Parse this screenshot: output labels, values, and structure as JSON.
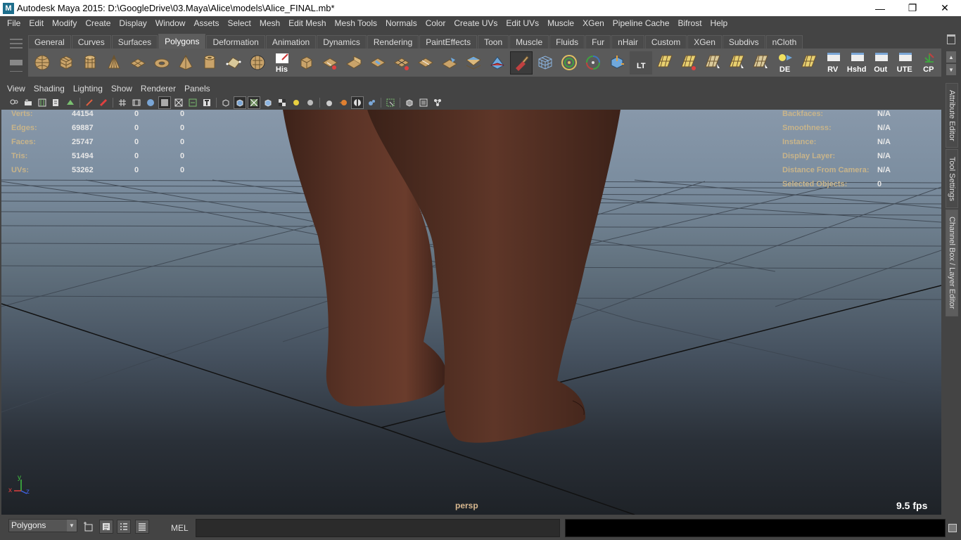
{
  "window": {
    "title": "Autodesk Maya 2015: D:\\GoogleDrive\\03.Maya\\Alice\\models\\Alice_FINAL.mb*",
    "icon_letter": "M",
    "controls": [
      {
        "name": "minimize-icon",
        "glyph": "—"
      },
      {
        "name": "restore-icon",
        "glyph": "❐"
      },
      {
        "name": "close-icon",
        "glyph": "✕"
      }
    ]
  },
  "menubar": [
    "File",
    "Edit",
    "Modify",
    "Create",
    "Display",
    "Window",
    "Assets",
    "Select",
    "Mesh",
    "Edit Mesh",
    "Mesh Tools",
    "Normals",
    "Color",
    "Create UVs",
    "Edit UVs",
    "Muscle",
    "XGen",
    "Pipeline Cache",
    "Bifrost",
    "Help"
  ],
  "shelf": {
    "tabs": [
      "General",
      "Curves",
      "Surfaces",
      "Polygons",
      "Deformation",
      "Animation",
      "Dynamics",
      "Rendering",
      "PaintEffects",
      "Toon",
      "Muscle",
      "Fluids",
      "Fur",
      "nHair",
      "Custom",
      "XGen",
      "Subdivs",
      "nCloth"
    ],
    "active_tab": "Polygons",
    "icons": [
      {
        "name": "poly-sphere-icon"
      },
      {
        "name": "poly-cube-icon"
      },
      {
        "name": "poly-cylinder-icon"
      },
      {
        "name": "poly-cone-icon"
      },
      {
        "name": "poly-plane-icon"
      },
      {
        "name": "poly-torus-icon"
      },
      {
        "name": "poly-pyramid-icon"
      },
      {
        "name": "poly-pipe-icon"
      },
      {
        "name": "create-polygon-tool-icon"
      },
      {
        "name": "sculpt-geometry-icon"
      },
      {
        "name": "history-icon",
        "label": "His"
      },
      {
        "name": "extrude-icon"
      },
      {
        "name": "bevel-icon"
      },
      {
        "name": "bridge-icon"
      },
      {
        "name": "append-polygon-icon"
      },
      {
        "name": "split-polygon-icon"
      },
      {
        "name": "insert-edge-loop-icon"
      },
      {
        "name": "merge-vertices-icon"
      },
      {
        "name": "merge-edge-icon"
      },
      {
        "name": "sculpt-tool-icon"
      },
      {
        "name": "paint-weights-icon",
        "selected": true
      },
      {
        "name": "wireframe-cube-icon"
      },
      {
        "name": "target-weld-icon"
      },
      {
        "name": "multi-cut-icon"
      },
      {
        "name": "transform-component-icon"
      },
      {
        "name": "lt-tool-icon",
        "label": "LT"
      },
      {
        "name": "uv-layout-icon"
      },
      {
        "name": "uv-unfold-icon"
      },
      {
        "name": "uv-select-icon"
      },
      {
        "name": "uv-map-icon"
      },
      {
        "name": "uv-cut-icon"
      },
      {
        "name": "display-light-icon",
        "label": "DE"
      },
      {
        "name": "uv-editor-icon"
      },
      {
        "name": "rv-button-icon",
        "label": "RV"
      },
      {
        "name": "hshd-button-icon",
        "label": "Hshd"
      },
      {
        "name": "out-button-icon",
        "label": "Out"
      },
      {
        "name": "ute-button-icon",
        "label": "UTE"
      },
      {
        "name": "cp-button-icon",
        "label": "CP"
      }
    ]
  },
  "panel": {
    "menus": [
      "View",
      "Shading",
      "Lighting",
      "Show",
      "Renderer",
      "Panels"
    ]
  },
  "viewport": {
    "camera": "persp",
    "fps": "9.5 fps",
    "hud_left": [
      {
        "label": "Verts:",
        "values": [
          "44154",
          "0",
          "0"
        ]
      },
      {
        "label": "Edges:",
        "values": [
          "69887",
          "0",
          "0"
        ]
      },
      {
        "label": "Faces:",
        "values": [
          "25747",
          "0",
          "0"
        ]
      },
      {
        "label": "Tris:",
        "values": [
          "51494",
          "0",
          "0"
        ]
      },
      {
        "label": "UVs:",
        "values": [
          "53262",
          "0",
          "0"
        ]
      }
    ],
    "hud_right": [
      {
        "label": "Backfaces:",
        "value": "N/A"
      },
      {
        "label": "Smoothness:",
        "value": "N/A"
      },
      {
        "label": "Instance:",
        "value": "N/A"
      },
      {
        "label": "Display Layer:",
        "value": "N/A"
      },
      {
        "label": "Distance From Camera:",
        "value": "N/A"
      },
      {
        "label": "Selected Objects:",
        "value": "0"
      }
    ],
    "axis": {
      "x": "x",
      "y": "y",
      "z": "z"
    }
  },
  "side_tabs": [
    "Attribute Editor",
    "Tool Settings",
    "Channel Box / Layer Editor"
  ],
  "command_line": {
    "menu_set": "Polygons",
    "language": "MEL",
    "input": "",
    "output": ""
  }
}
